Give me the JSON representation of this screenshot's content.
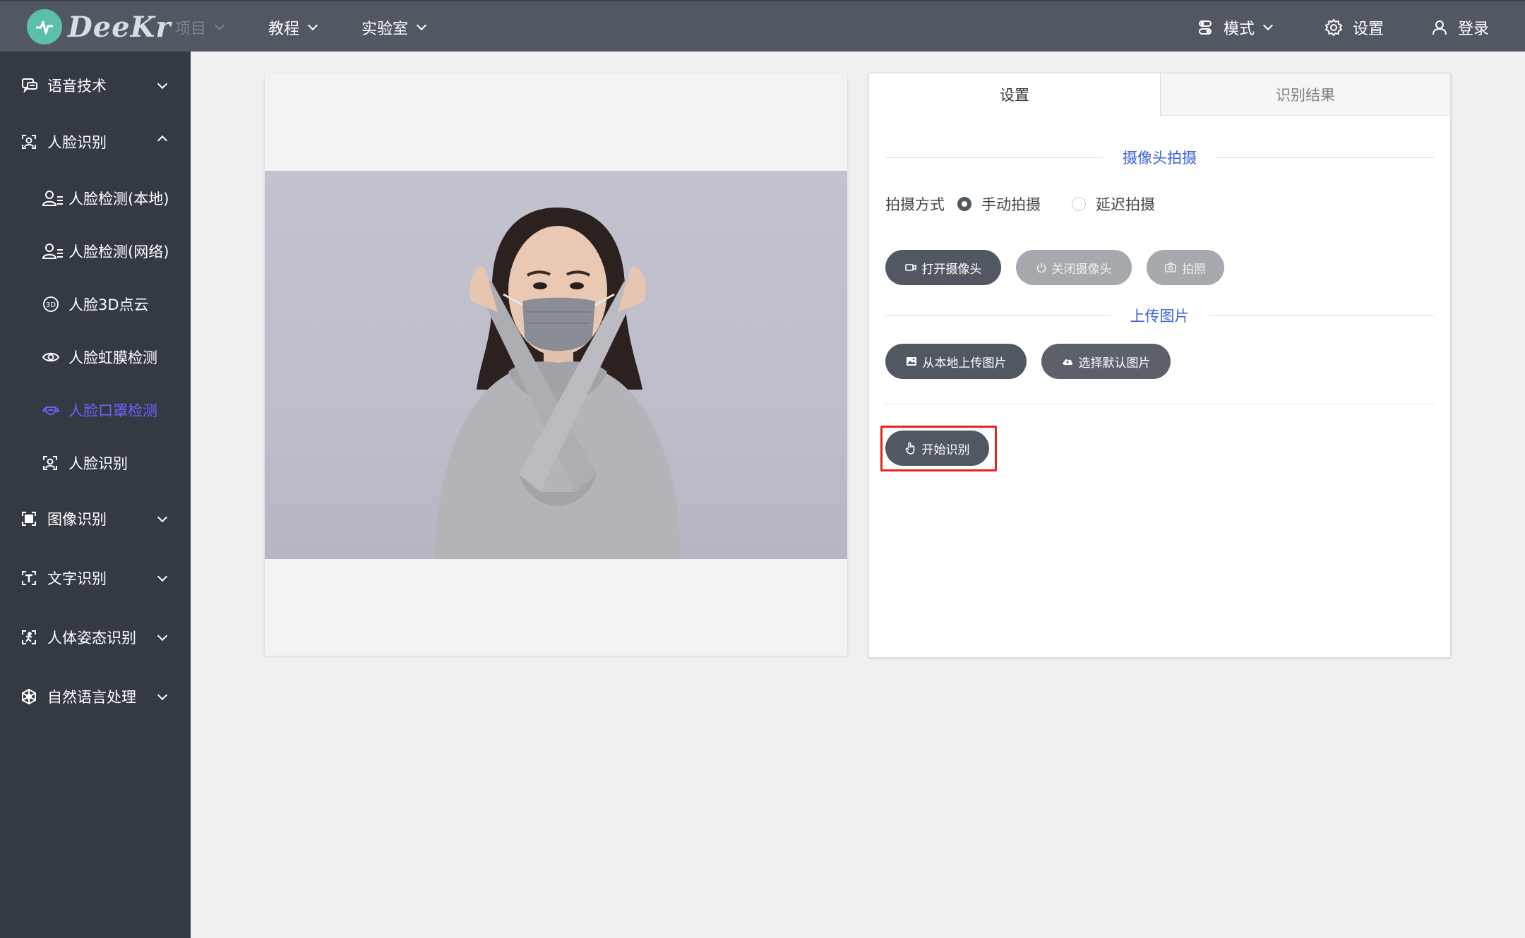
{
  "header": {
    "logo_text": "DeeKr",
    "nav": [
      {
        "label": "项目"
      },
      {
        "label": "教程"
      },
      {
        "label": "实验室"
      }
    ],
    "right": [
      {
        "label": "模式"
      },
      {
        "label": "设置"
      },
      {
        "label": "登录"
      }
    ]
  },
  "sidebar": {
    "items": [
      {
        "label": "语音技术",
        "icon": "speech-icon"
      },
      {
        "label": "人脸识别",
        "icon": "face-icon",
        "expanded": true
      },
      {
        "label": "人脸检测(本地)",
        "icon": "user-list-icon"
      },
      {
        "label": "人脸检测(网络)",
        "icon": "user-list-icon"
      },
      {
        "label": "人脸3D点云",
        "icon": "3d-icon"
      },
      {
        "label": "人脸虹膜检测",
        "icon": "eye-icon"
      },
      {
        "label": "人脸口罩检测",
        "icon": "mask-icon",
        "active": true
      },
      {
        "label": "人脸识别",
        "icon": "face-icon"
      },
      {
        "label": "图像识别",
        "icon": "image-scan-icon"
      },
      {
        "label": "文字识别",
        "icon": "text-scan-icon"
      },
      {
        "label": "人体姿态识别",
        "icon": "pose-icon"
      },
      {
        "label": "自然语言处理",
        "icon": "nlp-icon"
      }
    ]
  },
  "panel": {
    "tabs": [
      {
        "label": "设置"
      },
      {
        "label": "识别结果"
      }
    ],
    "camera_section": "摄像头拍摄",
    "mode_label": "拍摄方式",
    "mode_options": [
      {
        "label": "手动拍摄",
        "selected": true
      },
      {
        "label": "延迟拍摄",
        "selected": false
      }
    ],
    "camera_buttons": [
      {
        "label": "打开摄像头",
        "enabled": true
      },
      {
        "label": "关闭摄像头",
        "enabled": false
      },
      {
        "label": "拍照",
        "enabled": false
      }
    ],
    "upload_section": "上传图片",
    "upload_buttons": [
      {
        "label": "从本地上传图片"
      },
      {
        "label": "选择默认图片"
      }
    ],
    "start_button": "开始识别"
  },
  "colors": {
    "header_bg": "#525861",
    "sidebar_bg": "#343a42",
    "active": "#6c63ff",
    "section_title": "#3a62d6",
    "highlight": "#e8231b"
  }
}
